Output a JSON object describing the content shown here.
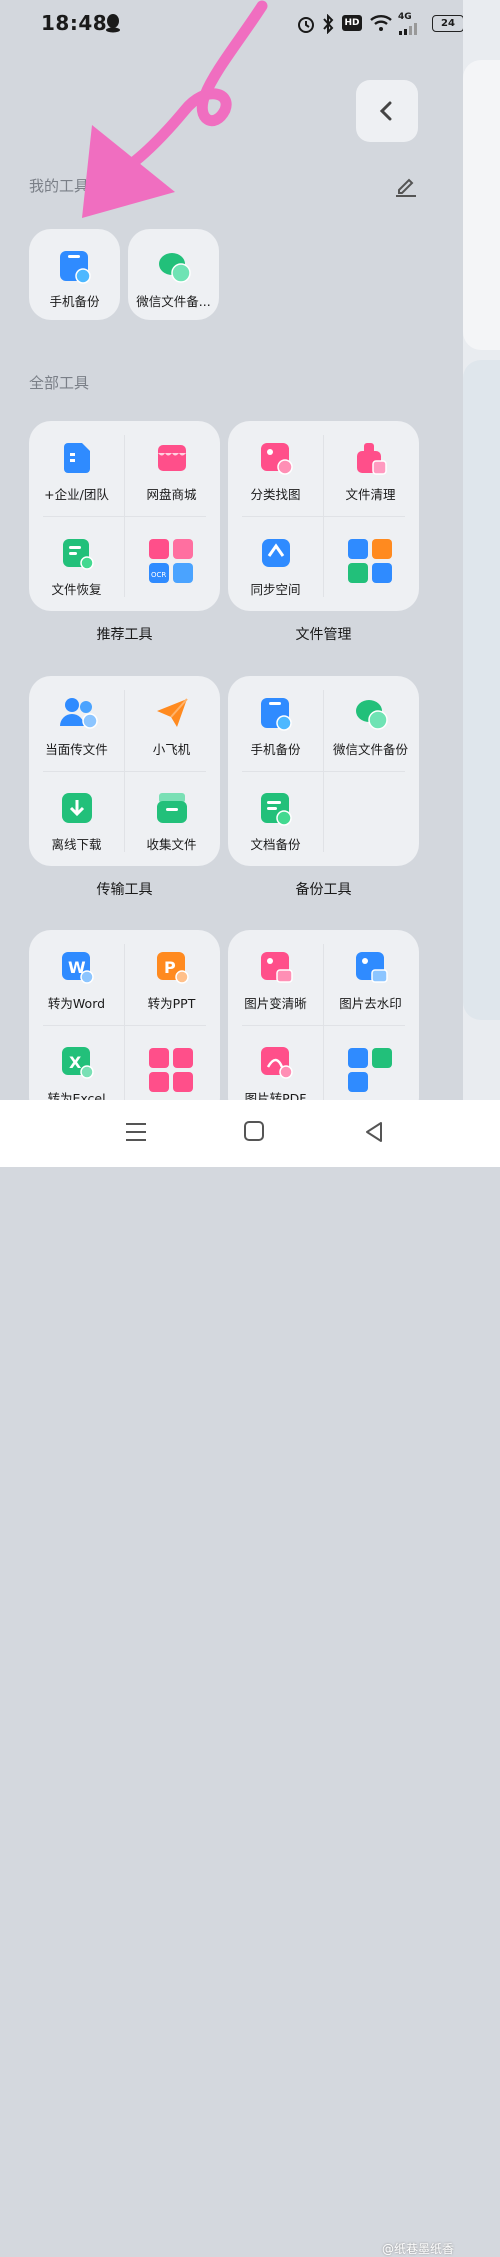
{
  "status_bar": {
    "time": "18:48",
    "network": "4G",
    "battery": "24"
  },
  "colors": {
    "accent_blue": "#2f8bff",
    "accent_green": "#22c07a",
    "accent_pink": "#ff4f8a",
    "accent_orange": "#ff8a1f",
    "annotation_pink": "#f06ec0"
  },
  "my_tools": {
    "title": "我的工具",
    "items": [
      {
        "label": "手机备份",
        "icon": "phone-backup-icon"
      },
      {
        "label": "微信文件备...",
        "icon": "wechat-file-backup-icon"
      }
    ]
  },
  "all_tools": {
    "title": "全部工具",
    "groups": [
      {
        "title": "推荐工具",
        "items": [
          {
            "label": "+企业/团队",
            "icon": "enterprise-team-icon"
          },
          {
            "label": "网盘商城",
            "icon": "netdisk-store-icon"
          },
          {
            "label": "文件恢复",
            "icon": "file-recovery-icon"
          },
          {
            "label": "",
            "icon": "more-tools-grid-icon"
          }
        ]
      },
      {
        "title": "文件管理",
        "items": [
          {
            "label": "分类找图",
            "icon": "photo-category-icon"
          },
          {
            "label": "文件清理",
            "icon": "file-cleanup-icon"
          },
          {
            "label": "同步空间",
            "icon": "sync-space-icon"
          },
          {
            "label": "",
            "icon": "more-tools-grid-icon"
          }
        ]
      },
      {
        "title": "传输工具",
        "items": [
          {
            "label": "当面传文件",
            "icon": "face-to-face-transfer-icon"
          },
          {
            "label": "小飞机",
            "icon": "paper-plane-icon"
          },
          {
            "label": "离线下载",
            "icon": "offline-download-icon"
          },
          {
            "label": "收集文件",
            "icon": "collect-files-icon"
          }
        ]
      },
      {
        "title": "备份工具",
        "items": [
          {
            "label": "手机备份",
            "icon": "phone-backup-icon"
          },
          {
            "label": "微信文件备份",
            "icon": "wechat-file-backup-icon"
          },
          {
            "label": "文档备份",
            "icon": "document-backup-icon"
          },
          {
            "label": "",
            "icon": ""
          }
        ]
      },
      {
        "title": "",
        "items": [
          {
            "label": "转为Word",
            "icon": "word-convert-icon"
          },
          {
            "label": "转为PPT",
            "icon": "ppt-convert-icon"
          },
          {
            "label": "转为Excel",
            "icon": "excel-convert-icon"
          },
          {
            "label": "",
            "icon": "more-tools-grid-icon"
          }
        ]
      },
      {
        "title": "",
        "items": [
          {
            "label": "图片变清晰",
            "icon": "image-hd-icon"
          },
          {
            "label": "图片去水印",
            "icon": "watermark-remove-icon"
          },
          {
            "label": "图片转PDF",
            "icon": "image-to-pdf-icon"
          },
          {
            "label": "",
            "icon": "more-tools-grid-icon"
          }
        ]
      }
    ]
  },
  "watermark": "@纸巷墨纸香"
}
